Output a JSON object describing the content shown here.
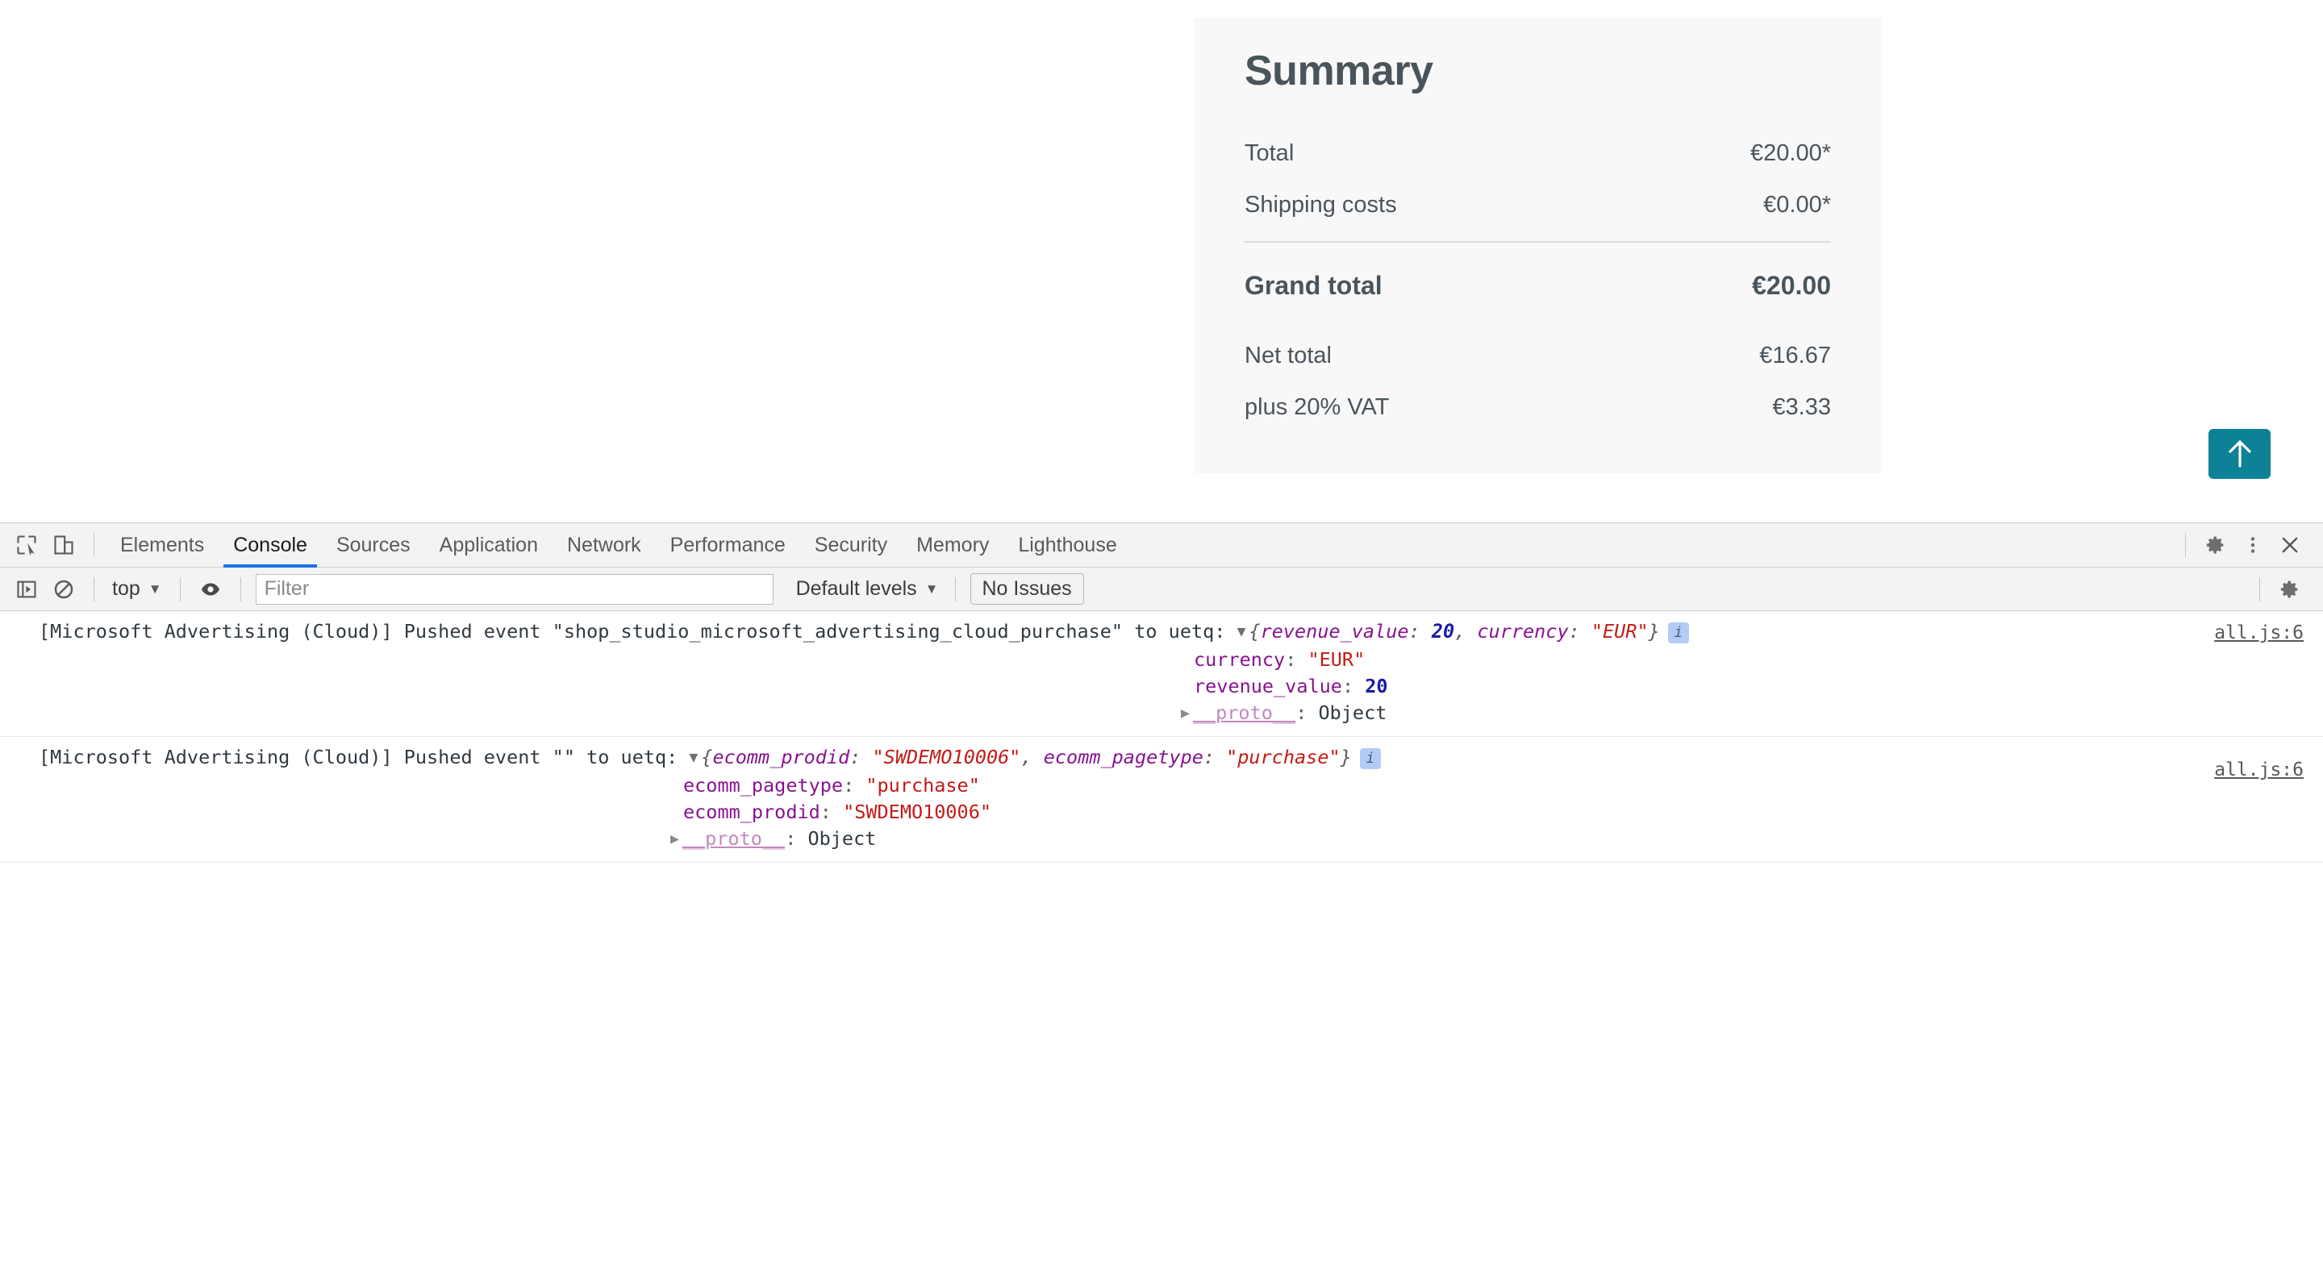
{
  "shop": {
    "summary": {
      "title": "Summary",
      "rows": [
        {
          "label": "Total",
          "value": "€20.00*"
        },
        {
          "label": "Shipping costs",
          "value": "€0.00*"
        }
      ],
      "grand": {
        "label": "Grand total",
        "value": "€20.00"
      },
      "tax_rows": [
        {
          "label": "Net total",
          "value": "€16.67"
        },
        {
          "label": "plus 20% VAT",
          "value": "€3.33"
        }
      ]
    },
    "scroll_top": {
      "icon": "arrow-up-icon",
      "color": "#0d8296"
    }
  },
  "devtools": {
    "tabs": [
      {
        "label": "Elements",
        "active": false
      },
      {
        "label": "Console",
        "active": true
      },
      {
        "label": "Sources",
        "active": false
      },
      {
        "label": "Application",
        "active": false
      },
      {
        "label": "Network",
        "active": false
      },
      {
        "label": "Performance",
        "active": false
      },
      {
        "label": "Security",
        "active": false
      },
      {
        "label": "Memory",
        "active": false
      },
      {
        "label": "Lighthouse",
        "active": false
      }
    ],
    "active_tab_accent": "#1a73e8",
    "left_icons": [
      {
        "name": "inspect-element-icon"
      },
      {
        "name": "device-toolbar-icon"
      }
    ],
    "right_icons": [
      {
        "name": "settings-gear-icon"
      },
      {
        "name": "more-options-icon"
      },
      {
        "name": "close-devtools-icon"
      }
    ],
    "filterbar": {
      "sidebar_toggle_icon": "console-sidebar-icon",
      "clear_icon": "clear-console-icon",
      "context": "top",
      "context_caret": "▼",
      "eye_icon": "live-expression-eye-icon",
      "filter_placeholder": "Filter",
      "filter_value": "",
      "levels": "Default levels",
      "levels_caret": "▼",
      "issues": "No Issues",
      "settings_icon": "console-settings-gear-icon"
    },
    "messages": [
      {
        "prefix": "[Microsoft Advertising (Cloud)] Pushed event ",
        "event_name": "\"shop_studio_microsoft_advertising_cloud_purchase\"",
        "middle": " to uetq: ",
        "expander": "▼",
        "preview": {
          "open": "{",
          "items": [
            {
              "key": "revenue_value",
              "sep": ": ",
              "value": "20",
              "type": "number"
            },
            {
              "key": "currency",
              "sep": ": ",
              "value": "\"EUR\"",
              "type": "string"
            }
          ],
          "close": "}"
        },
        "badge": "i",
        "props": [
          {
            "key": "currency",
            "sep": ": ",
            "value": "\"EUR\"",
            "type": "string"
          },
          {
            "key": "revenue_value",
            "sep": ": ",
            "value": "20",
            "type": "number"
          }
        ],
        "proto": {
          "expander": "▶",
          "key": "__proto__",
          "sep": ": ",
          "value": "Object"
        },
        "source": "all.js:6"
      },
      {
        "prefix": "[Microsoft Advertising (Cloud)] Pushed event ",
        "event_name": "\"\"",
        "middle": " to uetq: ",
        "expander": "▼",
        "preview": {
          "open": "{",
          "items": [
            {
              "key": "ecomm_prodid",
              "sep": ": ",
              "value": "\"SWDEMO10006\"",
              "type": "string"
            },
            {
              "key": "ecomm_pagetype",
              "sep": ": ",
              "value": "\"purchase\"",
              "type": "string"
            }
          ],
          "close": "}"
        },
        "badge": "i",
        "props": [
          {
            "key": "ecomm_pagetype",
            "sep": ": ",
            "value": "\"purchase\"",
            "type": "string"
          },
          {
            "key": "ecomm_prodid",
            "sep": ": ",
            "value": "\"SWDEMO10006\"",
            "type": "string"
          }
        ],
        "proto": {
          "expander": "▶",
          "key": "__proto__",
          "sep": ": ",
          "value": "Object"
        },
        "source": "all.js:6"
      }
    ]
  }
}
